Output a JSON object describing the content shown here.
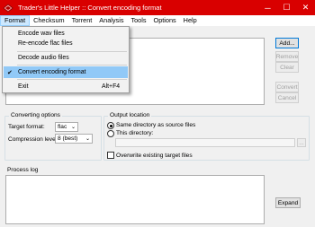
{
  "window": {
    "title": "Trader's Little Helper :: Convert encoding format",
    "minimize_glyph": "─",
    "maximize_glyph": "☐",
    "close_glyph": "✕"
  },
  "menubar": {
    "items": [
      "Format",
      "Checksum",
      "Torrent",
      "Analysis",
      "Tools",
      "Options",
      "Help"
    ],
    "active_index": 0
  },
  "format_menu": {
    "items": [
      {
        "label": "Encode wav files",
        "shortcut": "",
        "checked": false
      },
      {
        "label": "Re-encode flac files",
        "shortcut": "",
        "checked": false
      },
      {
        "label": "Decode audio files",
        "shortcut": "",
        "checked": false
      },
      {
        "label": "Convert encoding format",
        "shortcut": "",
        "checked": true
      },
      {
        "label": "Exit",
        "shortcut": "Alt+F4",
        "checked": false
      }
    ],
    "check_glyph": "✔"
  },
  "file_buttons": {
    "add": "Add...",
    "remove": "Remove",
    "clear": "Clear",
    "convert": "Convert",
    "cancel": "Cancel"
  },
  "converting_options": {
    "title": "Converting options",
    "target_format_label": "Target format:",
    "target_format_value": "flac",
    "compression_label": "Compression level:",
    "compression_value": "8 (best)",
    "arrow_glyph": "⌄"
  },
  "output_location": {
    "title": "Output location",
    "same_dir_label": "Same directory as source files",
    "same_dir_selected": true,
    "this_dir_label": "This directory:",
    "this_dir_value": "",
    "browse_label": "...",
    "overwrite_label": "Overwrite existing target files",
    "overwrite_checked": false
  },
  "process_log": {
    "title": "Process log",
    "expand_label": "Expand"
  },
  "colors": {
    "titlebar": "#d90000",
    "menu_highlight": "#91c9f7"
  }
}
